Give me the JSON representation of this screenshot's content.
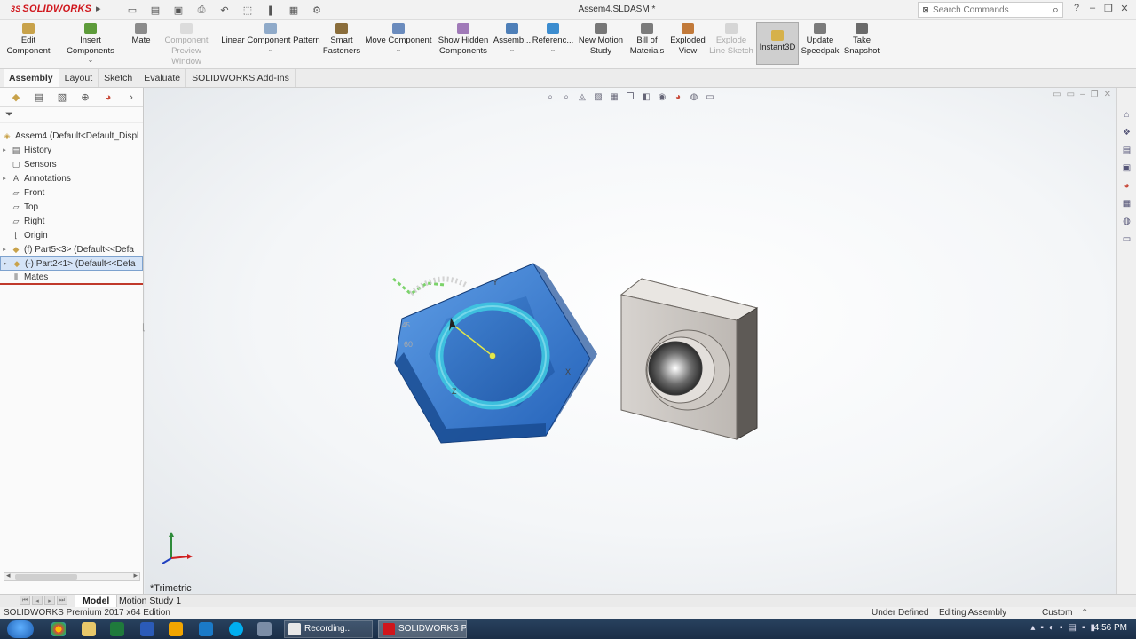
{
  "titlebar": {
    "app_name": "SOLIDWORKS",
    "brand_prefix": "3S",
    "document_title": "Assem4.SLDASM *",
    "search_placeholder": "Search Commands",
    "quick_access_icons": [
      "new-icon",
      "open-icon",
      "save-icon",
      "print-icon",
      "undo-icon",
      "select-icon",
      "rebuild-icon",
      "file-properties-icon",
      "options-icon"
    ]
  },
  "ribbon": {
    "buttons": [
      {
        "label": "Edit\nComponent",
        "icon": "edit-component-icon",
        "color": "#c8a24a"
      },
      {
        "label": "Insert Components",
        "icon": "insert-components-icon",
        "color": "#5d9b3a"
      },
      {
        "label": "Mate",
        "icon": "mate-icon",
        "color": "#8b8b8b"
      },
      {
        "label": "Component\nPreview Window",
        "icon": "preview-window-icon",
        "color": "#cfcfcf",
        "disabled": true
      },
      {
        "label": "Linear Component Pattern",
        "icon": "pattern-icon",
        "color": "#8faac9"
      },
      {
        "label": "Smart\nFasteners",
        "icon": "fasteners-icon",
        "color": "#8a6d3b"
      },
      {
        "label": "Move Component",
        "icon": "move-component-icon",
        "color": "#6a8bbd"
      },
      {
        "label": "Show Hidden\nComponents",
        "icon": "show-hidden-icon",
        "color": "#a07ab8"
      },
      {
        "label": "Assemb...",
        "icon": "assembly-features-icon",
        "color": "#4e7fb8"
      },
      {
        "label": "Referenc...",
        "icon": "reference-geometry-icon",
        "color": "#3b8ccf"
      },
      {
        "label": "New Motion\nStudy",
        "icon": "motion-study-icon",
        "color": "#777777"
      },
      {
        "label": "Bill of\nMaterials",
        "icon": "bom-icon",
        "color": "#7b7b7b"
      },
      {
        "label": "Exploded\nView",
        "icon": "exploded-view-icon",
        "color": "#c27a3a"
      },
      {
        "label": "Explode\nLine Sketch",
        "icon": "explode-line-icon",
        "color": "#d0d0d0",
        "disabled": true
      },
      {
        "label": "Instant3D",
        "icon": "instant3d-icon",
        "color": "#d6b14a",
        "active": true
      },
      {
        "label": "Update\nSpeedpak",
        "icon": "speedpak-icon",
        "color": "#7a7a7a"
      },
      {
        "label": "Take\nSnapshot",
        "icon": "snapshot-icon",
        "color": "#6a6a6a"
      }
    ]
  },
  "tabs": [
    "Assembly",
    "Layout",
    "Sketch",
    "Evaluate",
    "SOLIDWORKS Add-Ins"
  ],
  "tree": {
    "root": "Assem4  (Default<Default_Displ",
    "items": [
      {
        "label": "History",
        "icon": "history-icon",
        "expandable": true
      },
      {
        "label": "Sensors",
        "icon": "sensors-icon",
        "expandable": false
      },
      {
        "label": "Annotations",
        "icon": "annotations-icon",
        "expandable": true
      },
      {
        "label": "Front",
        "icon": "plane-icon",
        "expandable": false
      },
      {
        "label": "Top",
        "icon": "plane-icon",
        "expandable": false
      },
      {
        "label": "Right",
        "icon": "plane-icon",
        "expandable": false
      },
      {
        "label": "Origin",
        "icon": "origin-icon",
        "expandable": false
      },
      {
        "label": "(f) Part5<3> (Default<<Defa",
        "icon": "part-icon",
        "expandable": true
      },
      {
        "label": "(-) Part2<1> (Default<<Defa",
        "icon": "part-icon",
        "expandable": true,
        "selected": true
      },
      {
        "label": "Mates",
        "icon": "mates-icon",
        "expandable": false
      }
    ]
  },
  "viewport": {
    "view_label": "*Trimetric",
    "rotate_ruler_labels": [
      "45",
      "60"
    ],
    "axis_labels": [
      "Y",
      "X",
      "Z"
    ],
    "colors": {
      "blue_part": "#2e6fc4",
      "gray_part": "#8e8e8e",
      "ring": "#3ec6e0"
    }
  },
  "bottom_tabs": [
    "Model",
    "Motion Study 1"
  ],
  "statusbar": {
    "edition": "SOLIDWORKS Premium 2017 x64 Edition",
    "state": "Under Defined",
    "mode": "Editing Assembly",
    "units": "Custom"
  },
  "taskbar": {
    "tasks": [
      {
        "label": "Recording...",
        "color": "#e8e8e8"
      },
      {
        "label": "SOLIDWORKS P...",
        "color": "#d0161c"
      }
    ],
    "time": "4:56 PM"
  }
}
